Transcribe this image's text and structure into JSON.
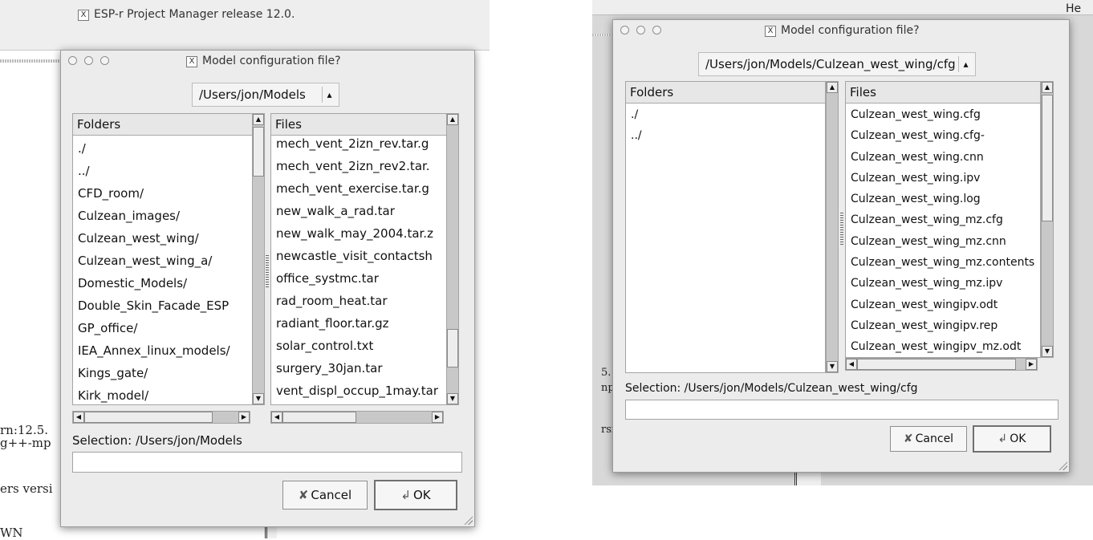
{
  "background_left": {
    "window_title": "ESP-r Project Manager release 12.0.",
    "frags": [
      "rn:12.5.",
      "g++-mp",
      "ers versi",
      "WN"
    ]
  },
  "background_right": {
    "menu_text": "He",
    "frags": [
      "5.",
      "np",
      "rsi"
    ]
  },
  "dialog1": {
    "title": "Model configuration file?",
    "path": "/Users/jon/Models",
    "folders_header": "Folders",
    "files_header": "Files",
    "folders": [
      "./",
      "../",
      "CFD_room/",
      "Culzean_images/",
      "Culzean_west_wing/",
      "Culzean_west_wing_a/",
      "Domestic_Models/",
      "Double_Skin_Facade_ESP",
      "GP_office/",
      "IEA_Annex_linux_models/",
      "Kings_gate/",
      "Kirk_model/"
    ],
    "files": [
      "mech_vent_2izn_rev.tar.g",
      "mech_vent_2izn_rev2.tar.",
      "mech_vent_exercise.tar.g",
      "new_walk_a_rad.tar",
      "new_walk_may_2004.tar.z",
      "newcastle_visit_contactsh",
      "office_systmc.tar",
      "rad_room_heat.tar",
      "radiant_floor.tar.gz",
      "solar_control.txt",
      "surgery_30jan.tar",
      "vent_displ_occup_1may.tar"
    ],
    "selection_label": "Selection: /Users/jon/Models",
    "selection_value": "",
    "cancel_label": "Cancel",
    "ok_label": "OK"
  },
  "dialog2": {
    "title": "Model configuration file?",
    "path": "/Users/jon/Models/Culzean_west_wing/cfg",
    "folders_header": "Folders",
    "files_header": "Files",
    "folders": [
      "./",
      "../"
    ],
    "files": [
      "Culzean_west_wing.cfg",
      "Culzean_west_wing.cfg-",
      "Culzean_west_wing.cnn",
      "Culzean_west_wing.ipv",
      "Culzean_west_wing.log",
      "Culzean_west_wing_mz.cfg",
      "Culzean_west_wing_mz.cnn",
      "Culzean_west_wing_mz.contents",
      "Culzean_west_wing_mz.ipv",
      "Culzean_west_wingipv.odt",
      "Culzean_west_wingipv.rep",
      "Culzean_west_wingipv_mz.odt"
    ],
    "selection_label": "Selection: /Users/jon/Models/Culzean_west_wing/cfg",
    "selection_value": "",
    "cancel_label": "Cancel",
    "ok_label": "OK"
  },
  "icons": {
    "window_x": "X-window-icon",
    "cancel": "cancel-icon",
    "ok": "ok-return-icon",
    "updown": "updown-arrows-icon"
  }
}
